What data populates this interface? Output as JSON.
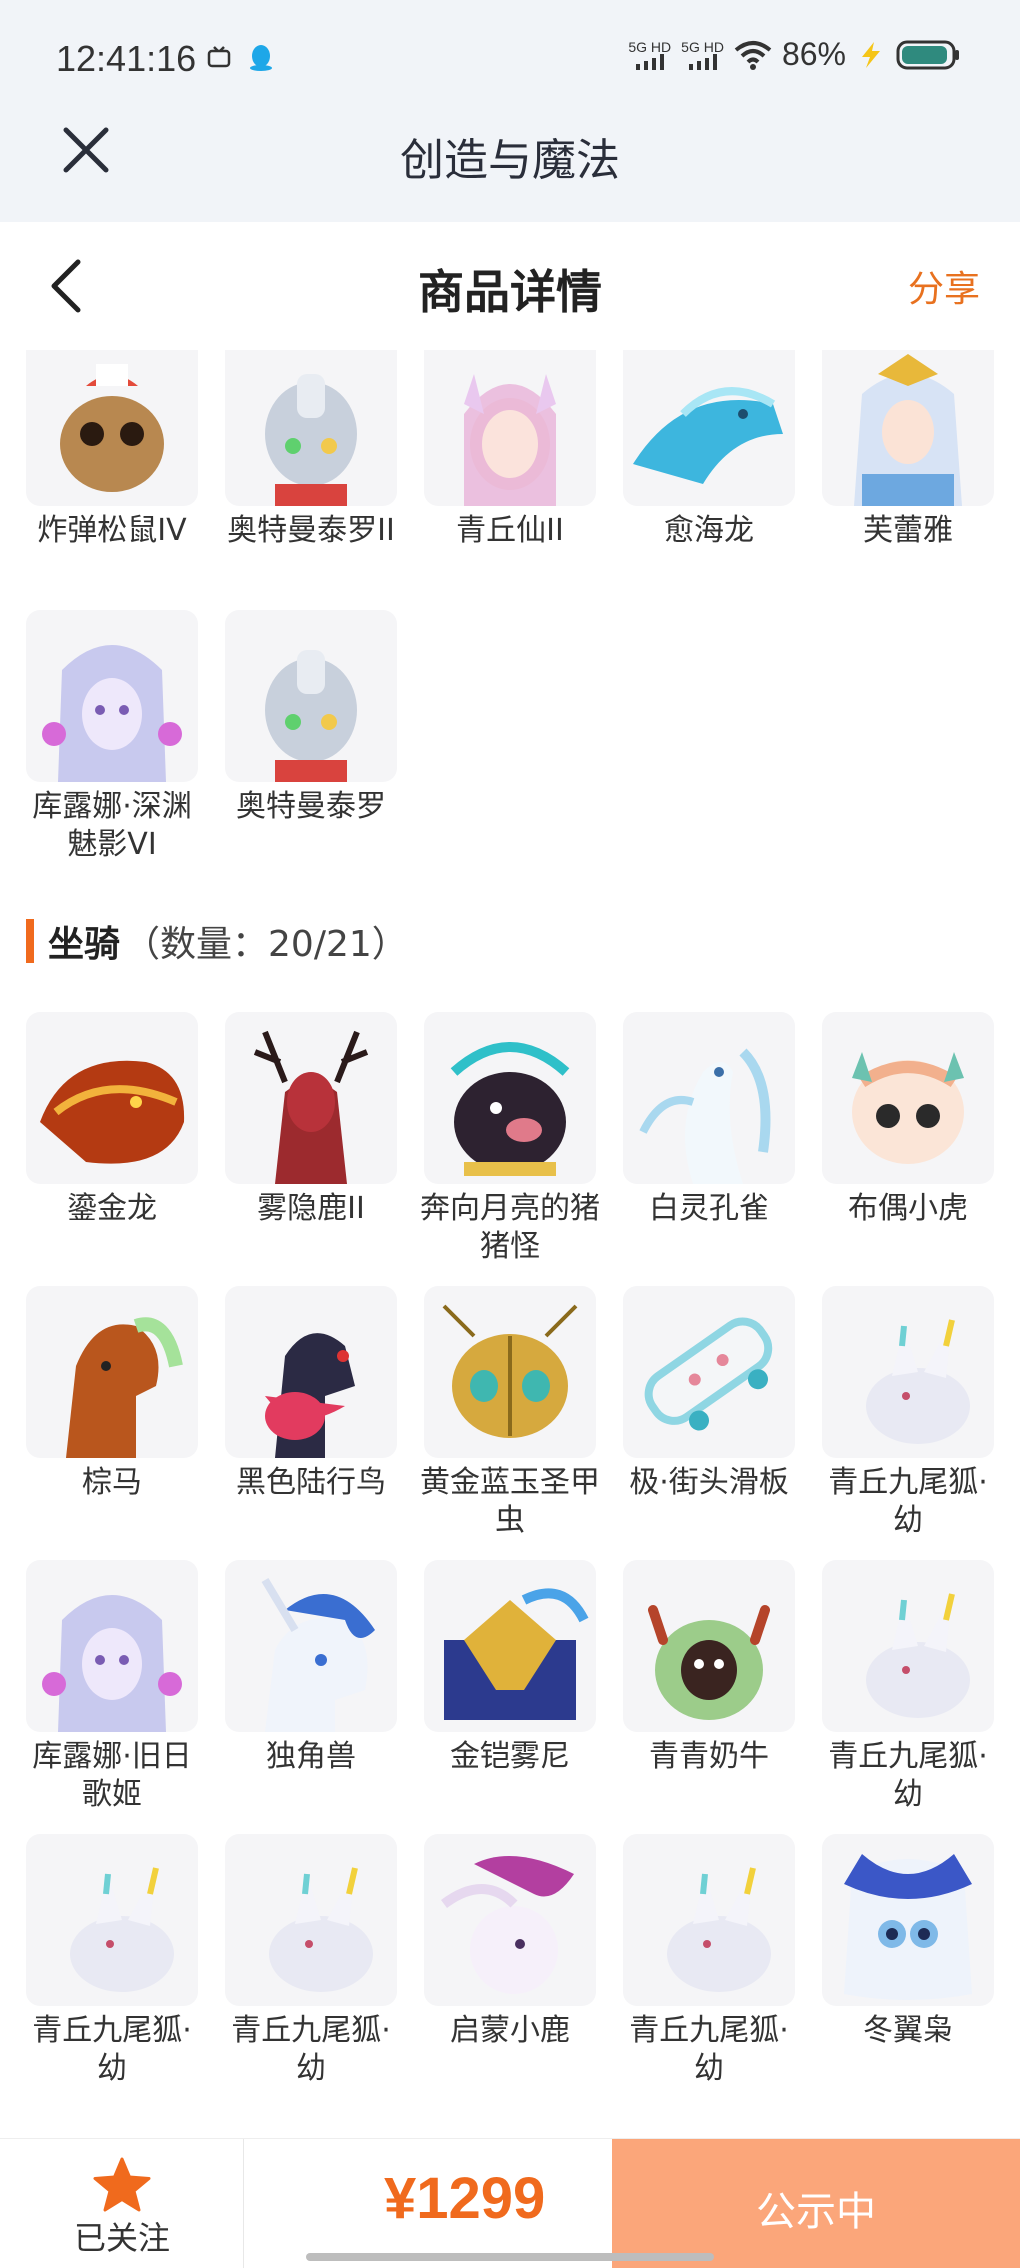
{
  "status": {
    "time": "12:41:16",
    "sig1": "5G HD",
    "sig2": "5G HD",
    "battery": "86%"
  },
  "appbar": {
    "title": "创造与魔法"
  },
  "nav": {
    "title": "商品详情",
    "share": "分享"
  },
  "fashion_items": [
    {
      "name": "炸弹松鼠IV",
      "icon": "squirrel-icon",
      "color": "#b88850"
    },
    {
      "name": "奥特曼泰罗II",
      "icon": "ultraman-icon",
      "color": "#c8d0dc"
    },
    {
      "name": "青丘仙II",
      "icon": "fox-fairy-icon",
      "color": "#e9b3d8"
    },
    {
      "name": "愈海龙",
      "icon": "sea-dragon-icon",
      "color": "#3db6de"
    },
    {
      "name": "芙蕾雅",
      "icon": "freya-icon",
      "color": "#6da8e0"
    },
    {
      "name": "库露娜·深渊魅影VI",
      "icon": "kuluna-icon",
      "color": "#c8c9ee"
    },
    {
      "name": "奥特曼泰罗",
      "icon": "ultraman-icon",
      "color": "#c8d0dc"
    }
  ],
  "section": {
    "title": "坐骑",
    "count": "（数量：20/21）"
  },
  "mounts": [
    {
      "name": "鎏金龙",
      "icon": "gold-dragon-icon",
      "color": "#b43a12"
    },
    {
      "name": "雾隐鹿II",
      "icon": "deer-icon",
      "color": "#9c2a2e"
    },
    {
      "name": "奔向月亮的猪猪怪",
      "icon": "pig-icon",
      "color": "#2d2230"
    },
    {
      "name": "白灵孔雀",
      "icon": "peacock-icon",
      "color": "#a9d8ef"
    },
    {
      "name": "布偶小虎",
      "icon": "tiger-icon",
      "color": "#f2b08d"
    },
    {
      "name": "棕马",
      "icon": "horse-icon",
      "color": "#b9561d"
    },
    {
      "name": "黑色陆行鸟",
      "icon": "black-bird-icon",
      "color": "#2b2a44"
    },
    {
      "name": "黄金蓝玉圣甲虫",
      "icon": "scarab-icon",
      "color": "#d6a93e"
    },
    {
      "name": "极·街头滑板",
      "icon": "skateboard-icon",
      "color": "#8fd6e3"
    },
    {
      "name": "青丘九尾狐·幼",
      "icon": "fox-cub-icon",
      "color": "#e8e9f3"
    },
    {
      "name": "库露娜·旧日歌姬",
      "icon": "kuluna-icon",
      "color": "#c8c9ee"
    },
    {
      "name": "独角兽",
      "icon": "unicorn-icon",
      "color": "#3a6ed1"
    },
    {
      "name": "金铠雾尼",
      "icon": "armor-bird-icon",
      "color": "#2c3a8e"
    },
    {
      "name": "青青奶牛",
      "icon": "cow-icon",
      "color": "#9ccc8a"
    },
    {
      "name": "青丘九尾狐·幼",
      "icon": "fox-cub-icon",
      "color": "#e8e9f3"
    },
    {
      "name": "青丘九尾狐·幼",
      "icon": "fox-cub-icon",
      "color": "#e8e9f3"
    },
    {
      "name": "青丘九尾狐·幼",
      "icon": "fox-cub-icon",
      "color": "#e8e9f3"
    },
    {
      "name": "启蒙小鹿",
      "icon": "fawn-icon",
      "color": "#b33fa0"
    },
    {
      "name": "青丘九尾狐·幼",
      "icon": "fox-cub-icon",
      "color": "#e8e9f3"
    },
    {
      "name": "冬翼枭",
      "icon": "owl-icon",
      "color": "#3b57c7"
    }
  ],
  "bottom": {
    "follow": "已关注",
    "price": "¥1299",
    "buy": "公示中"
  },
  "colors": {
    "accent": "#f06a1d",
    "button": "#fba67a"
  }
}
